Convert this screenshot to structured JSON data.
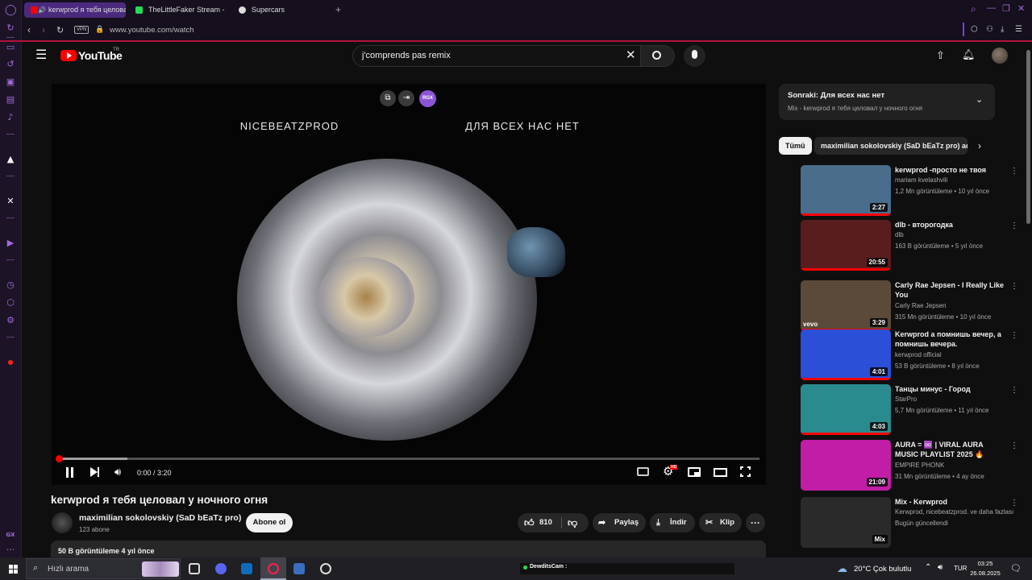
{
  "browser": {
    "tabs": [
      {
        "title": "kerwprod я тебя целовал у ночного огня",
        "active": true
      },
      {
        "title": "TheLittleFaker Stream - V"
      },
      {
        "title": "Supercars"
      }
    ],
    "vpn_label": "VPN",
    "url": "www.youtube.com/watch"
  },
  "sidebar_icons": [
    "opera-icon",
    "refresh-icon",
    "messenger-icon",
    "history-icon",
    "box-icon",
    "wallet-icon",
    "music-icon",
    "aria-icon",
    "x-icon",
    "player-icon",
    "clock-icon",
    "extension-icon",
    "settings-icon",
    "notification-icon",
    "gx-icon",
    "more-icon"
  ],
  "youtube": {
    "logo_text": "YouTube",
    "logo_country": "TR",
    "search_value": "j'comprends pas remix",
    "video": {
      "overlay_left": "NICEBEATZPROD",
      "overlay_right": "ДЛЯ ВСЕХ НАС НЕТ",
      "time": "0:00 / 3:20",
      "progress": 0.0,
      "rgx_label": "RGX",
      "settings_badge": "HD"
    },
    "title": "kerwprod я тебя целовал у ночного огня",
    "channel": "maximilian sokolovskiy (SaD bEaTz pro)",
    "subscribers": "123 abone",
    "subscribe_label": "Abone ol",
    "like_count": "810",
    "share_label": "Paylaş",
    "download_label": "İndir",
    "clip_label": "Klip",
    "views_line": "50 B görüntüleme  4 yıl önce",
    "next": {
      "prefix": "Sonraki:",
      "title": "Для всех нас нет",
      "subtitle": "Mix - kerwprod я тебя целовал у ночного огня"
    },
    "chips": [
      "Tümü",
      "maximilian sokolovskiy (SaD bEaTz pro) ad"
    ],
    "recommendations": [
      {
        "title": "kerwprod -просто не твоя",
        "channel": "mariam kvelashvili",
        "meta": "1,2 Mn görüntüleme • 10 yıl önce",
        "duration": "2:27",
        "thumb_color": "#4a6d8c",
        "progress": 1.0
      },
      {
        "title": "dlb - второгодка",
        "channel": "dlb",
        "meta": "163 B görüntüleme • 5 yıl önce",
        "duration": "20:55",
        "thumb_color": "#5a1d1d",
        "progress": 1.0
      },
      {
        "title": "Carly Rae Jepsen - I Really Like You",
        "channel": "Carly Rae Jepsen",
        "meta": "315 Mn görüntüleme • 10 yıl önce",
        "duration": "3:29",
        "thumb_color": "#5b4a3a",
        "progress": 1.0,
        "badge": "vevo"
      },
      {
        "title": "Kerwprod   а помнишь вечер, а помнишь вечера.",
        "channel": "kerwprod official",
        "meta": "53 B görüntüleme • 8 yıl önce",
        "duration": "4:01",
        "thumb_color": "#2b4fd6",
        "progress": 1.0
      },
      {
        "title": "Танцы минус - Город",
        "channel": "StarPro",
        "meta": "5,7 Mn görüntüleme • 11 yıl önce",
        "duration": "4:03",
        "thumb_color": "#2a8b8f",
        "progress": 1.0
      },
      {
        "title": "AURA = ♾️ | VIRAL AURA MUSIC PLAYLIST 2025 🔥",
        "channel": "EMPIRE PHONK",
        "meta": "31 Mn görüntüleme • 4 ay önce",
        "duration": "21:09",
        "thumb_color": "#c21da6",
        "progress": 0.0
      },
      {
        "title": "Mix - Kerwprod",
        "channel": "Kerwprod, nicebeatzprod. ve daha fazlası",
        "meta": "Bugün güncellendi",
        "duration": "Mix",
        "thumb_color": "#2a2a2a",
        "progress": 0.0
      }
    ]
  },
  "taskbar": {
    "search_placeholder": "Hızlı arama",
    "stream_label": "DewditsCam :",
    "weather": "20°C  Çok bulutlu",
    "language": "TUR",
    "time": "03:25",
    "date": "26.08.2025"
  }
}
